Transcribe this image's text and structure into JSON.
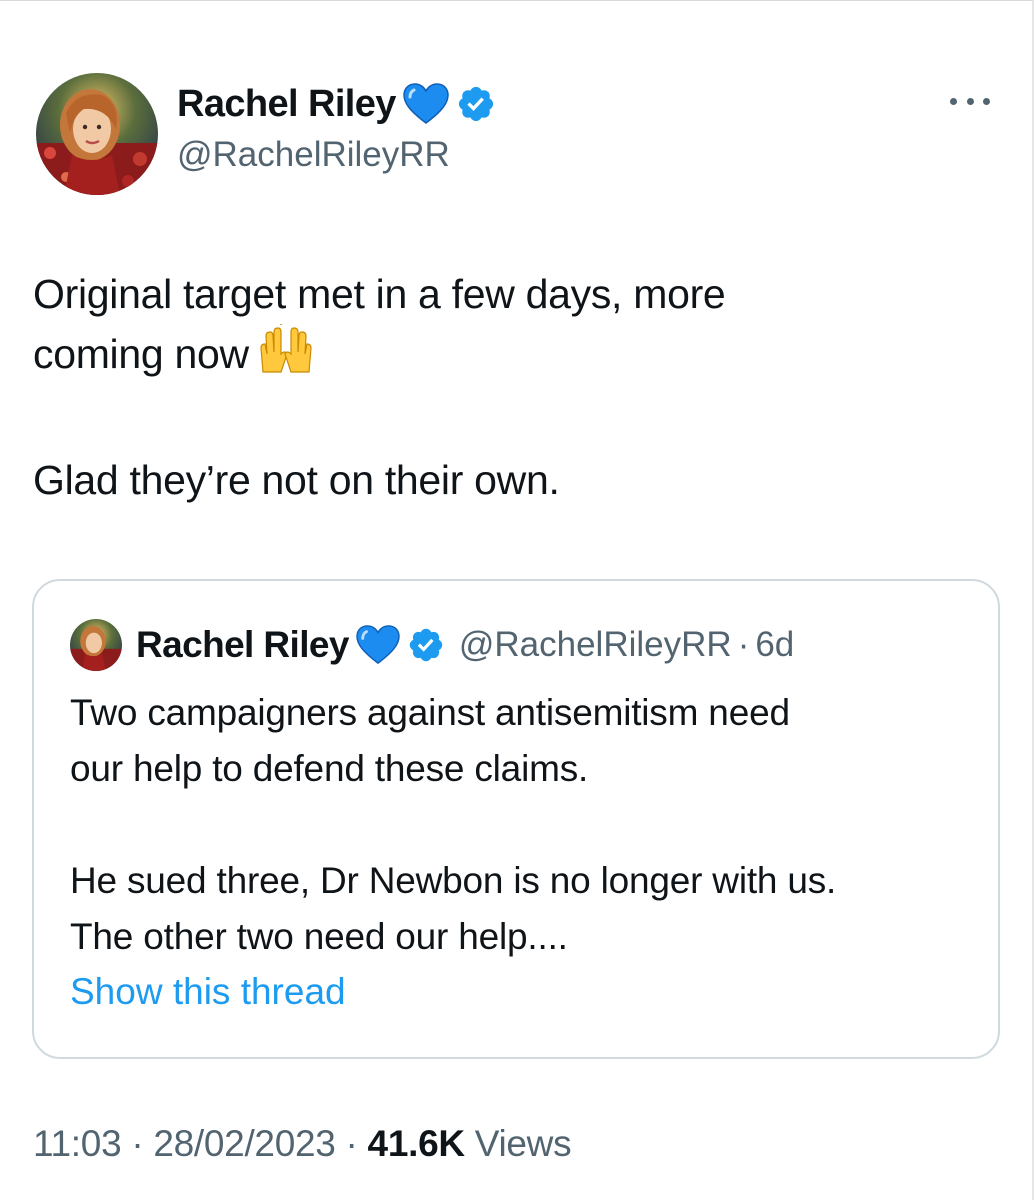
{
  "tweet": {
    "author": {
      "display_name": "Rachel Riley",
      "handle": "@RachelRileyRR",
      "avatar_icon": "profile-photo",
      "badge_icons": [
        "blue-heart-icon",
        "verified-badge-icon"
      ]
    },
    "more_icon": "more-options-icon",
    "text": {
      "line1": "Original target met in a few days, more",
      "line2": "coming now",
      "emoji": "raising-hands-emoji",
      "line3": "Glad they’re not on their own."
    },
    "quoted": {
      "display_name": "Rachel Riley",
      "handle": "@RachelRileyRR",
      "separator": "·",
      "time": "6d",
      "text": {
        "line1": "Two campaigners against antisemitism need",
        "line2": "our help to defend these claims.",
        "line3": "He sued three, Dr Newbon is no longer with us.",
        "line4": "The other two need our help...."
      },
      "show_thread": "Show this thread"
    },
    "meta": {
      "time": "11:03",
      "separator": "·",
      "date": "28/02/2023",
      "views_count": "41.6K",
      "views_label": "Views"
    }
  },
  "colors": {
    "link": "#1d9bf0",
    "verified": "#1d9bf0",
    "heart": "#1d8cf0",
    "secondary_text": "#536471",
    "primary_text": "#0f1419",
    "border": "#cfd9de"
  }
}
